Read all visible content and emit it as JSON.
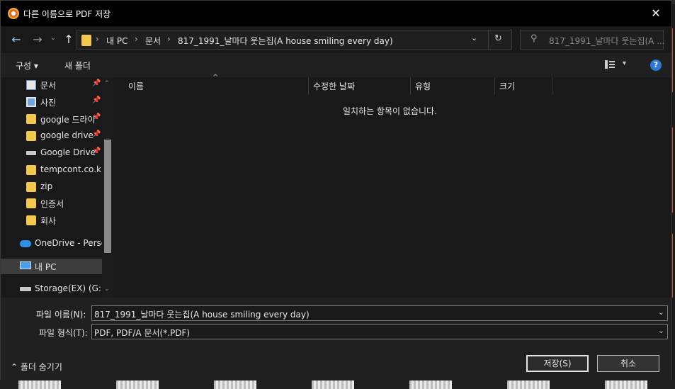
{
  "title_bar": {
    "title": "다른 이름으로 PDF 저장",
    "close_glyph": "✕"
  },
  "nav": {
    "back_glyph": "←",
    "forward_glyph": "→",
    "recent_glyph": "⌄",
    "up_glyph": "↑",
    "breadcrumb": [
      "내 PC",
      "문서",
      "817_1991_날마다 웃는집(A house smiling every day)"
    ],
    "sep_glyph": "›",
    "dropdown_glyph": "⌄",
    "refresh_glyph": "↻",
    "search_placeholder": "817_1991_날마다 웃는집(A ...",
    "search_glyph": "⚲"
  },
  "toolbar": {
    "organize": "구성 ▾",
    "new_folder": "새 폴더",
    "view_dropdown": "▾",
    "help": "?"
  },
  "navpane": {
    "items": [
      {
        "label": "문서",
        "icon": "document-icon",
        "pinned": true
      },
      {
        "label": "사진",
        "icon": "pictures-icon",
        "pinned": true
      },
      {
        "label": "google 드라이",
        "icon": "folder-icon",
        "pinned": true
      },
      {
        "label": "google drive",
        "icon": "folder-icon",
        "pinned": true
      },
      {
        "label": "Google Drive",
        "icon": "drive-icon",
        "pinned": true
      },
      {
        "label": "tempcont.co.kr",
        "icon": "folder-icon",
        "pinned": false
      },
      {
        "label": "zip",
        "icon": "folder-icon",
        "pinned": false
      },
      {
        "label": "인증서",
        "icon": "folder-icon",
        "pinned": false
      },
      {
        "label": "회사",
        "icon": "folder-icon",
        "pinned": false
      },
      {
        "label": "OneDrive - Person",
        "icon": "onedrive-icon",
        "pinned": false
      },
      {
        "label": "내 PC",
        "icon": "pc-icon",
        "pinned": false,
        "selected": true
      },
      {
        "label": "Storage(EX) (G:)",
        "icon": "drive-icon",
        "pinned": false
      }
    ],
    "pin_glyph": "📌",
    "scroll_up": "⌃",
    "scroll_down": "⌄"
  },
  "filelist": {
    "columns": [
      "이름",
      "수정한 날짜",
      "유형",
      "크기"
    ],
    "sort_glyph": "^",
    "empty_message": "일치하는 항목이 없습니다."
  },
  "form": {
    "filename_label": "파일 이름(N):",
    "filename_value": "817_1991_날마다 웃는집(A house smiling every day)",
    "filetype_label": "파일 형식(T):",
    "filetype_value": "PDF, PDF/A 문서(*.PDF)",
    "dropdown_glyph": "⌄",
    "hide_folders": "⌃  폴더 숨기기",
    "save_button": "저장(S)",
    "cancel_button": "취소"
  },
  "colors": {
    "accent": "#2c7ad6",
    "folder": "#f4c84a",
    "background": "#202020",
    "titlebar": "#000000"
  }
}
